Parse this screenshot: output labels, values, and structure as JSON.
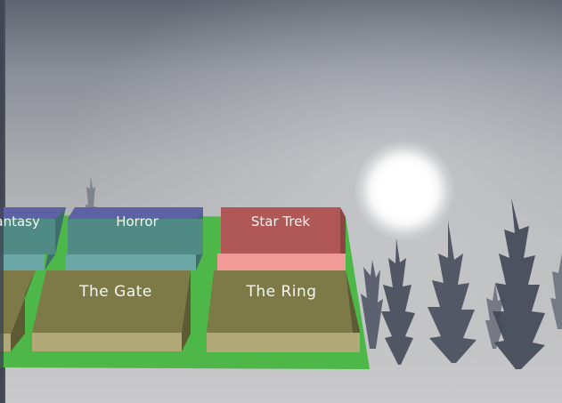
{
  "categories": [
    {
      "label": "Fantasy",
      "color": "#4f8a84",
      "side": "#6aa7a6",
      "top": "#5c62a4"
    },
    {
      "label": "Horror",
      "color": "#4f8a84",
      "side": "#6aa7a6",
      "top": "#5c62a4"
    },
    {
      "label": "Star Trek",
      "color": "#b05858",
      "side": "#f19a98",
      "top": "#c06060",
      "selected": true
    }
  ],
  "movies": [
    {
      "label": ""
    },
    {
      "label": "The Gate"
    },
    {
      "label": "The Ring"
    }
  ],
  "colors": {
    "board_green": "#4db848",
    "movie_tile": "#7d7a47",
    "movie_tile_front": "#b0a877",
    "moon": "#ffffff"
  }
}
